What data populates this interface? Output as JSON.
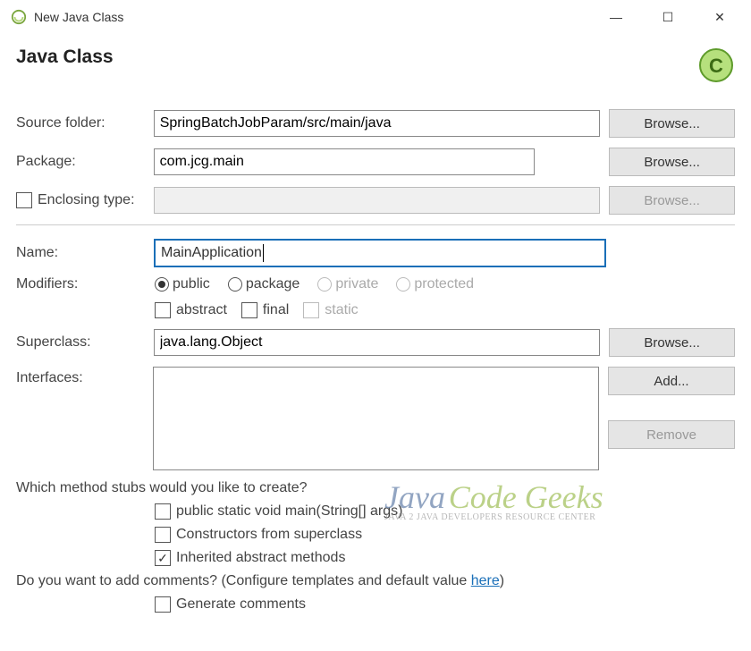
{
  "window": {
    "title": "New Java Class"
  },
  "header": {
    "title": "Java Class"
  },
  "fields": {
    "source_folder": {
      "label": "Source folder:",
      "value": "SpringBatchJobParam/src/main/java"
    },
    "package": {
      "label": "Package:",
      "value": "com.jcg.main"
    },
    "enclosing_type": {
      "label": "Enclosing type:",
      "value": ""
    },
    "name": {
      "label": "Name:",
      "value": "MainApplication"
    },
    "modifiers": {
      "label": "Modifiers:"
    },
    "superclass": {
      "label": "Superclass:",
      "value": "java.lang.Object"
    },
    "interfaces": {
      "label": "Interfaces:"
    }
  },
  "modifiers": {
    "visibility": {
      "public": "public",
      "package": "package",
      "private": "private",
      "protected": "protected",
      "selected": "public"
    },
    "flags": {
      "abstract": "abstract",
      "final": "final",
      "static": "static"
    }
  },
  "buttons": {
    "browse": "Browse...",
    "add": "Add...",
    "remove": "Remove"
  },
  "stubs": {
    "question": "Which method stubs would you like to create?",
    "main": "public static void main(String[] args)",
    "constructors": "Constructors from superclass",
    "inherited": "Inherited abstract methods"
  },
  "comments": {
    "question_prefix": "Do you want to add comments? (Configure templates and default value ",
    "link": "here",
    "question_suffix": ")",
    "generate": "Generate comments"
  },
  "watermark": {
    "t1": "Java",
    "t2": "Code Geeks",
    "sub": "JAVA 2 JAVA DEVELOPERS RESOURCE CENTER"
  }
}
